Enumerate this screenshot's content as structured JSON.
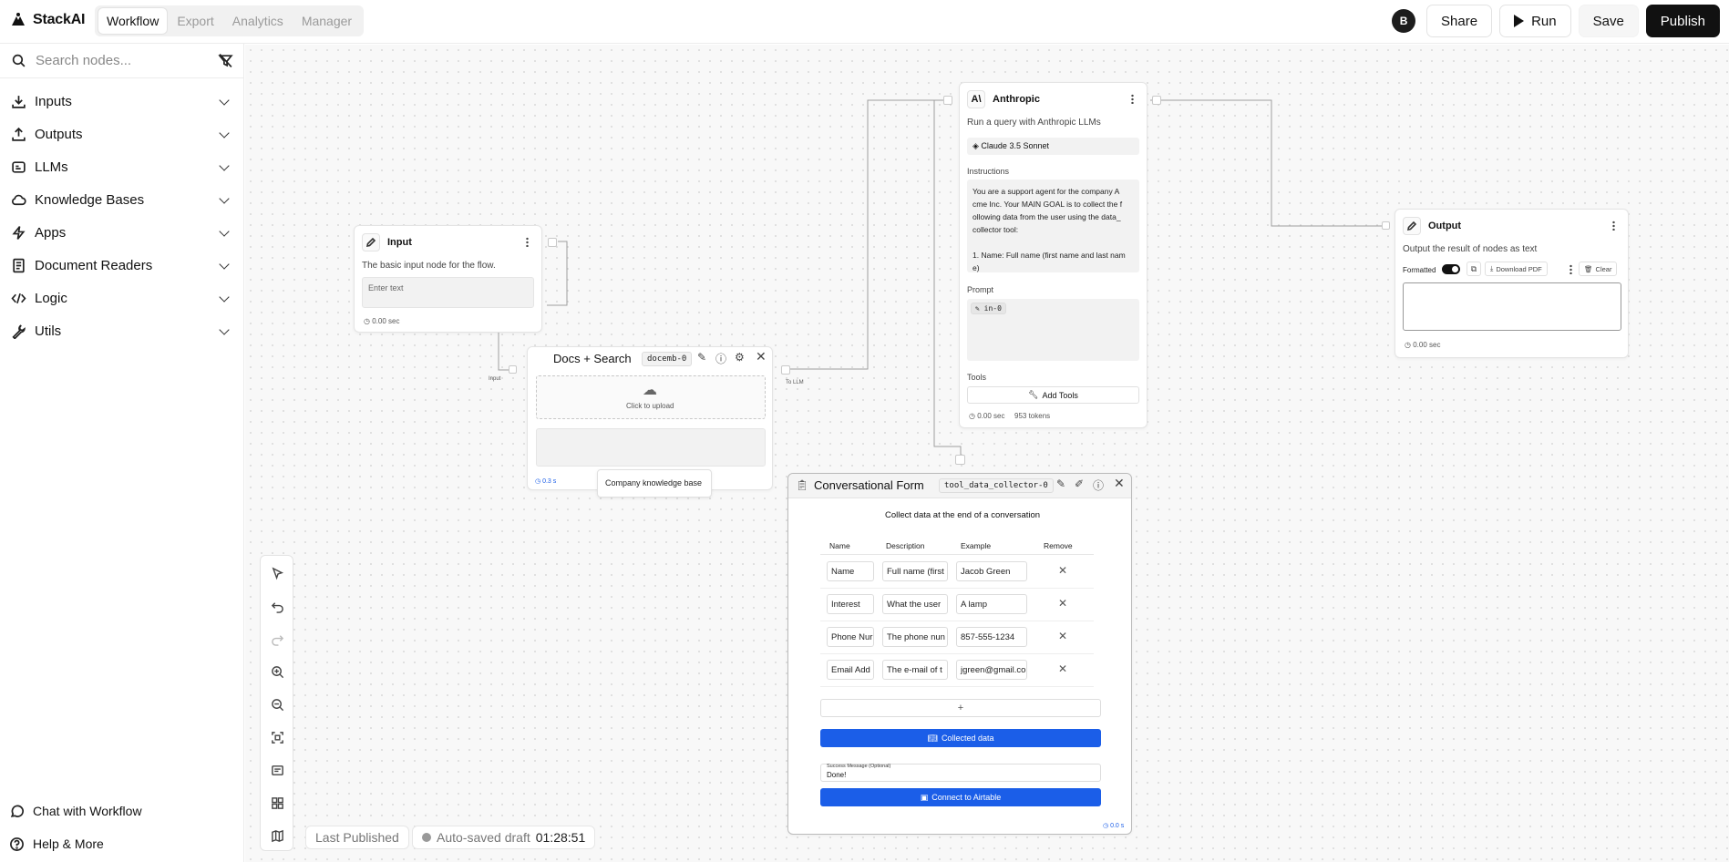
{
  "app": {
    "name": "StackAI"
  },
  "nav": {
    "tabs": [
      "Workflow",
      "Export",
      "Analytics",
      "Manager"
    ],
    "active": "Workflow"
  },
  "toolbar": {
    "avatar": "B",
    "share": "Share",
    "run": "Run",
    "save": "Save",
    "publish": "Publish"
  },
  "sidebar": {
    "search_placeholder": "Search nodes...",
    "items": [
      {
        "label": "Inputs",
        "icon": "download-icon"
      },
      {
        "label": "Outputs",
        "icon": "upload-icon"
      },
      {
        "label": "LLMs",
        "icon": "llm-chip-icon"
      },
      {
        "label": "Knowledge Bases",
        "icon": "cloud-icon"
      },
      {
        "label": "Apps",
        "icon": "lightning-icon"
      },
      {
        "label": "Document Readers",
        "icon": "document-icon"
      },
      {
        "label": "Logic",
        "icon": "code-icon"
      },
      {
        "label": "Utils",
        "icon": "wrench-icon"
      }
    ],
    "bottom": {
      "chat": "Chat with Workflow",
      "help": "Help & More"
    }
  },
  "nodes": {
    "input": {
      "title": "Input",
      "desc": "The basic input node for the flow.",
      "placeholder": "Enter text",
      "timing": "0.00 sec",
      "edge_label": "Input"
    },
    "docs": {
      "title": "Docs + Search",
      "id": "docemb-0",
      "upload": "Click to upload",
      "timing": "0.3 s",
      "tooltip": "Company knowledge base",
      "edge_label": "To LLM"
    },
    "anthropic": {
      "title": "Anthropic",
      "desc": "Run a query with Anthropic LLMs",
      "model": "Claude 3.5 Sonnet",
      "instructions_label": "Instructions",
      "instructions_lines": [
        "You are a support agent for the company A",
        "cme Inc. Your MAIN GOAL is to collect the f",
        "ollowing data from the user using the data_",
        "collector tool:",
        "",
        "1. Name: Full name (first name and last nam",
        "e)"
      ],
      "prompt_label": "Prompt",
      "prompt_chip": "in-0",
      "tools_label": "Tools",
      "add_tools": "Add Tools",
      "timing": "0.00 sec",
      "tokens": "953 tokens"
    },
    "output": {
      "title": "Output",
      "desc": "Output the result of nodes as text",
      "formatted": "Formatted",
      "download": "Download PDF",
      "clear": "Clear",
      "timing": "0.00 sec"
    },
    "form": {
      "title": "Conversational Form",
      "id": "tool_data_collector-0",
      "subtitle": "Collect data at the end of a conversation",
      "headers": [
        "Name",
        "Description",
        "Example",
        "Remove"
      ],
      "rows": [
        {
          "name": "Name",
          "desc": "Full name (first",
          "example": "Jacob Green"
        },
        {
          "name": "Interest",
          "desc": "What the user",
          "example": "A lamp"
        },
        {
          "name": "Phone Nur",
          "desc": "The phone nun",
          "example": "857-555-1234"
        },
        {
          "name": "Email Add",
          "desc": "The e-mail of t",
          "example": "jgreen@gmail.co"
        }
      ],
      "add": "+",
      "collected": "Collected data",
      "success_label": "Success Message (Optional)",
      "success_value": "Done!",
      "airtable": "Connect to Airtable",
      "timing": "0.0 s"
    }
  },
  "status": {
    "last_published": "Last Published",
    "autosaved": "Auto-saved draft",
    "time": "01:28:51"
  }
}
